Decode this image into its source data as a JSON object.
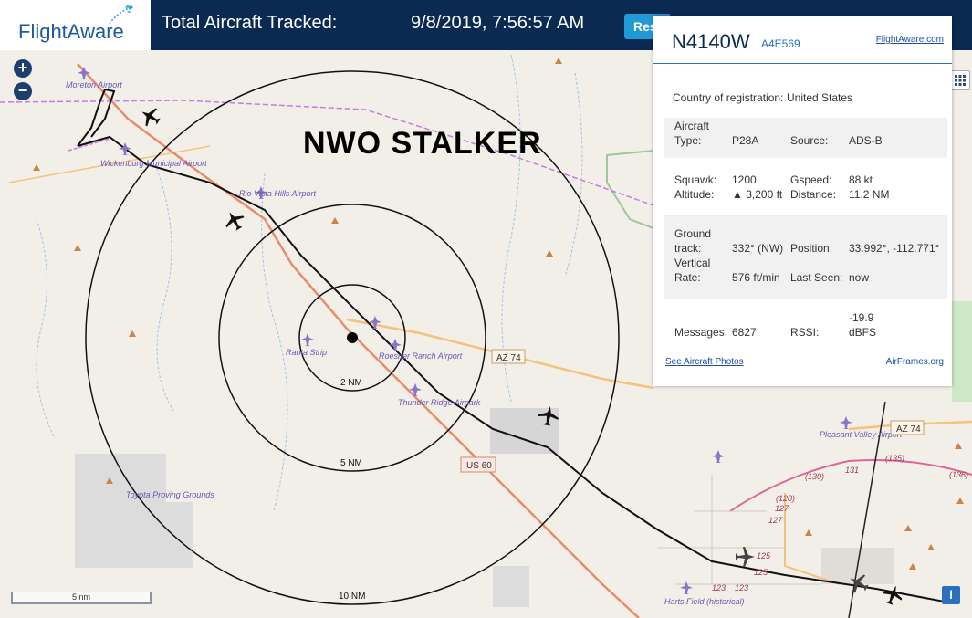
{
  "header": {
    "logo_text": "FlightAware",
    "total_label": "Total Aircraft Tracked:",
    "timestamp": "9/8/2019, 7:56:57 AM",
    "reset_label": "Res"
  },
  "overlay_title": "NWO STALKER",
  "map": {
    "places": {
      "moreton": "Moreton Airport",
      "wickenburg": "Wickenburg Municipal Airport",
      "rio_vista": "Rio Vista Hills Airport",
      "ranta": "Ranta Strip",
      "roesner": "Roesner Ranch Airport",
      "thunder": "Thunder Ridge Airpark",
      "toyota": "Toyota Proving Grounds",
      "pleasant": "Pleasant Valley Airport",
      "harts": "Harts Field (historical)"
    },
    "roads": {
      "az74": "AZ 74",
      "az74b": "AZ 74",
      "us60": "US 60",
      "r135": "(135)",
      "r136": "(136)",
      "r130": "(130)",
      "r131": "131",
      "r128": "(128)",
      "r127a": "127",
      "r127b": "127",
      "r125a": "125",
      "r125b": "125",
      "r123a": "123",
      "r123b": "123"
    },
    "rings": {
      "r2": "2 NM",
      "r5": "5 NM",
      "r10": "10 NM"
    },
    "scale": "5 nm"
  },
  "panel": {
    "registration": "N4140W",
    "hex": "A4E569",
    "fa_link": "FlightAware.com",
    "country_label": "Country of registration:",
    "country_value": "United States",
    "aircraft_label_1": "Aircraft",
    "aircraft_label_2": "Type:",
    "type_value": "P28A",
    "source_label": "Source:",
    "source_value": "ADS-B",
    "squawk_label": "Squawk:",
    "squawk_value": "1200",
    "gspeed_label": "Gspeed:",
    "gspeed_value": "88 kt",
    "altitude_label": "Altitude:",
    "altitude_value": "▲ 3,200 ft",
    "distance_label": "Distance:",
    "distance_value": "11.2 NM",
    "ground_label_1": "Ground",
    "ground_label_2": "track:",
    "track_value": "332° (NW)",
    "position_label": "Position:",
    "position_value": "33.992°, -112.771°",
    "vertical_label_1": "Vertical",
    "vertical_label_2": "Rate:",
    "rate_value": "576 ft/min",
    "lastseen_label": "Last Seen:",
    "lastseen_value": "now",
    "messages_label": "Messages:",
    "messages_value": "6827",
    "rssi_label": "RSSI:",
    "rssi_value_1": "-19.9",
    "rssi_value_2": "dBFS",
    "photos_link": "See Aircraft Photos",
    "airframes_link": "AirFrames.org"
  },
  "colors": {
    "header_bg": "#0a2a52",
    "accent": "#1f9ad6",
    "primary_road": "#e88c6a",
    "secondary_road": "#f5c27a"
  }
}
